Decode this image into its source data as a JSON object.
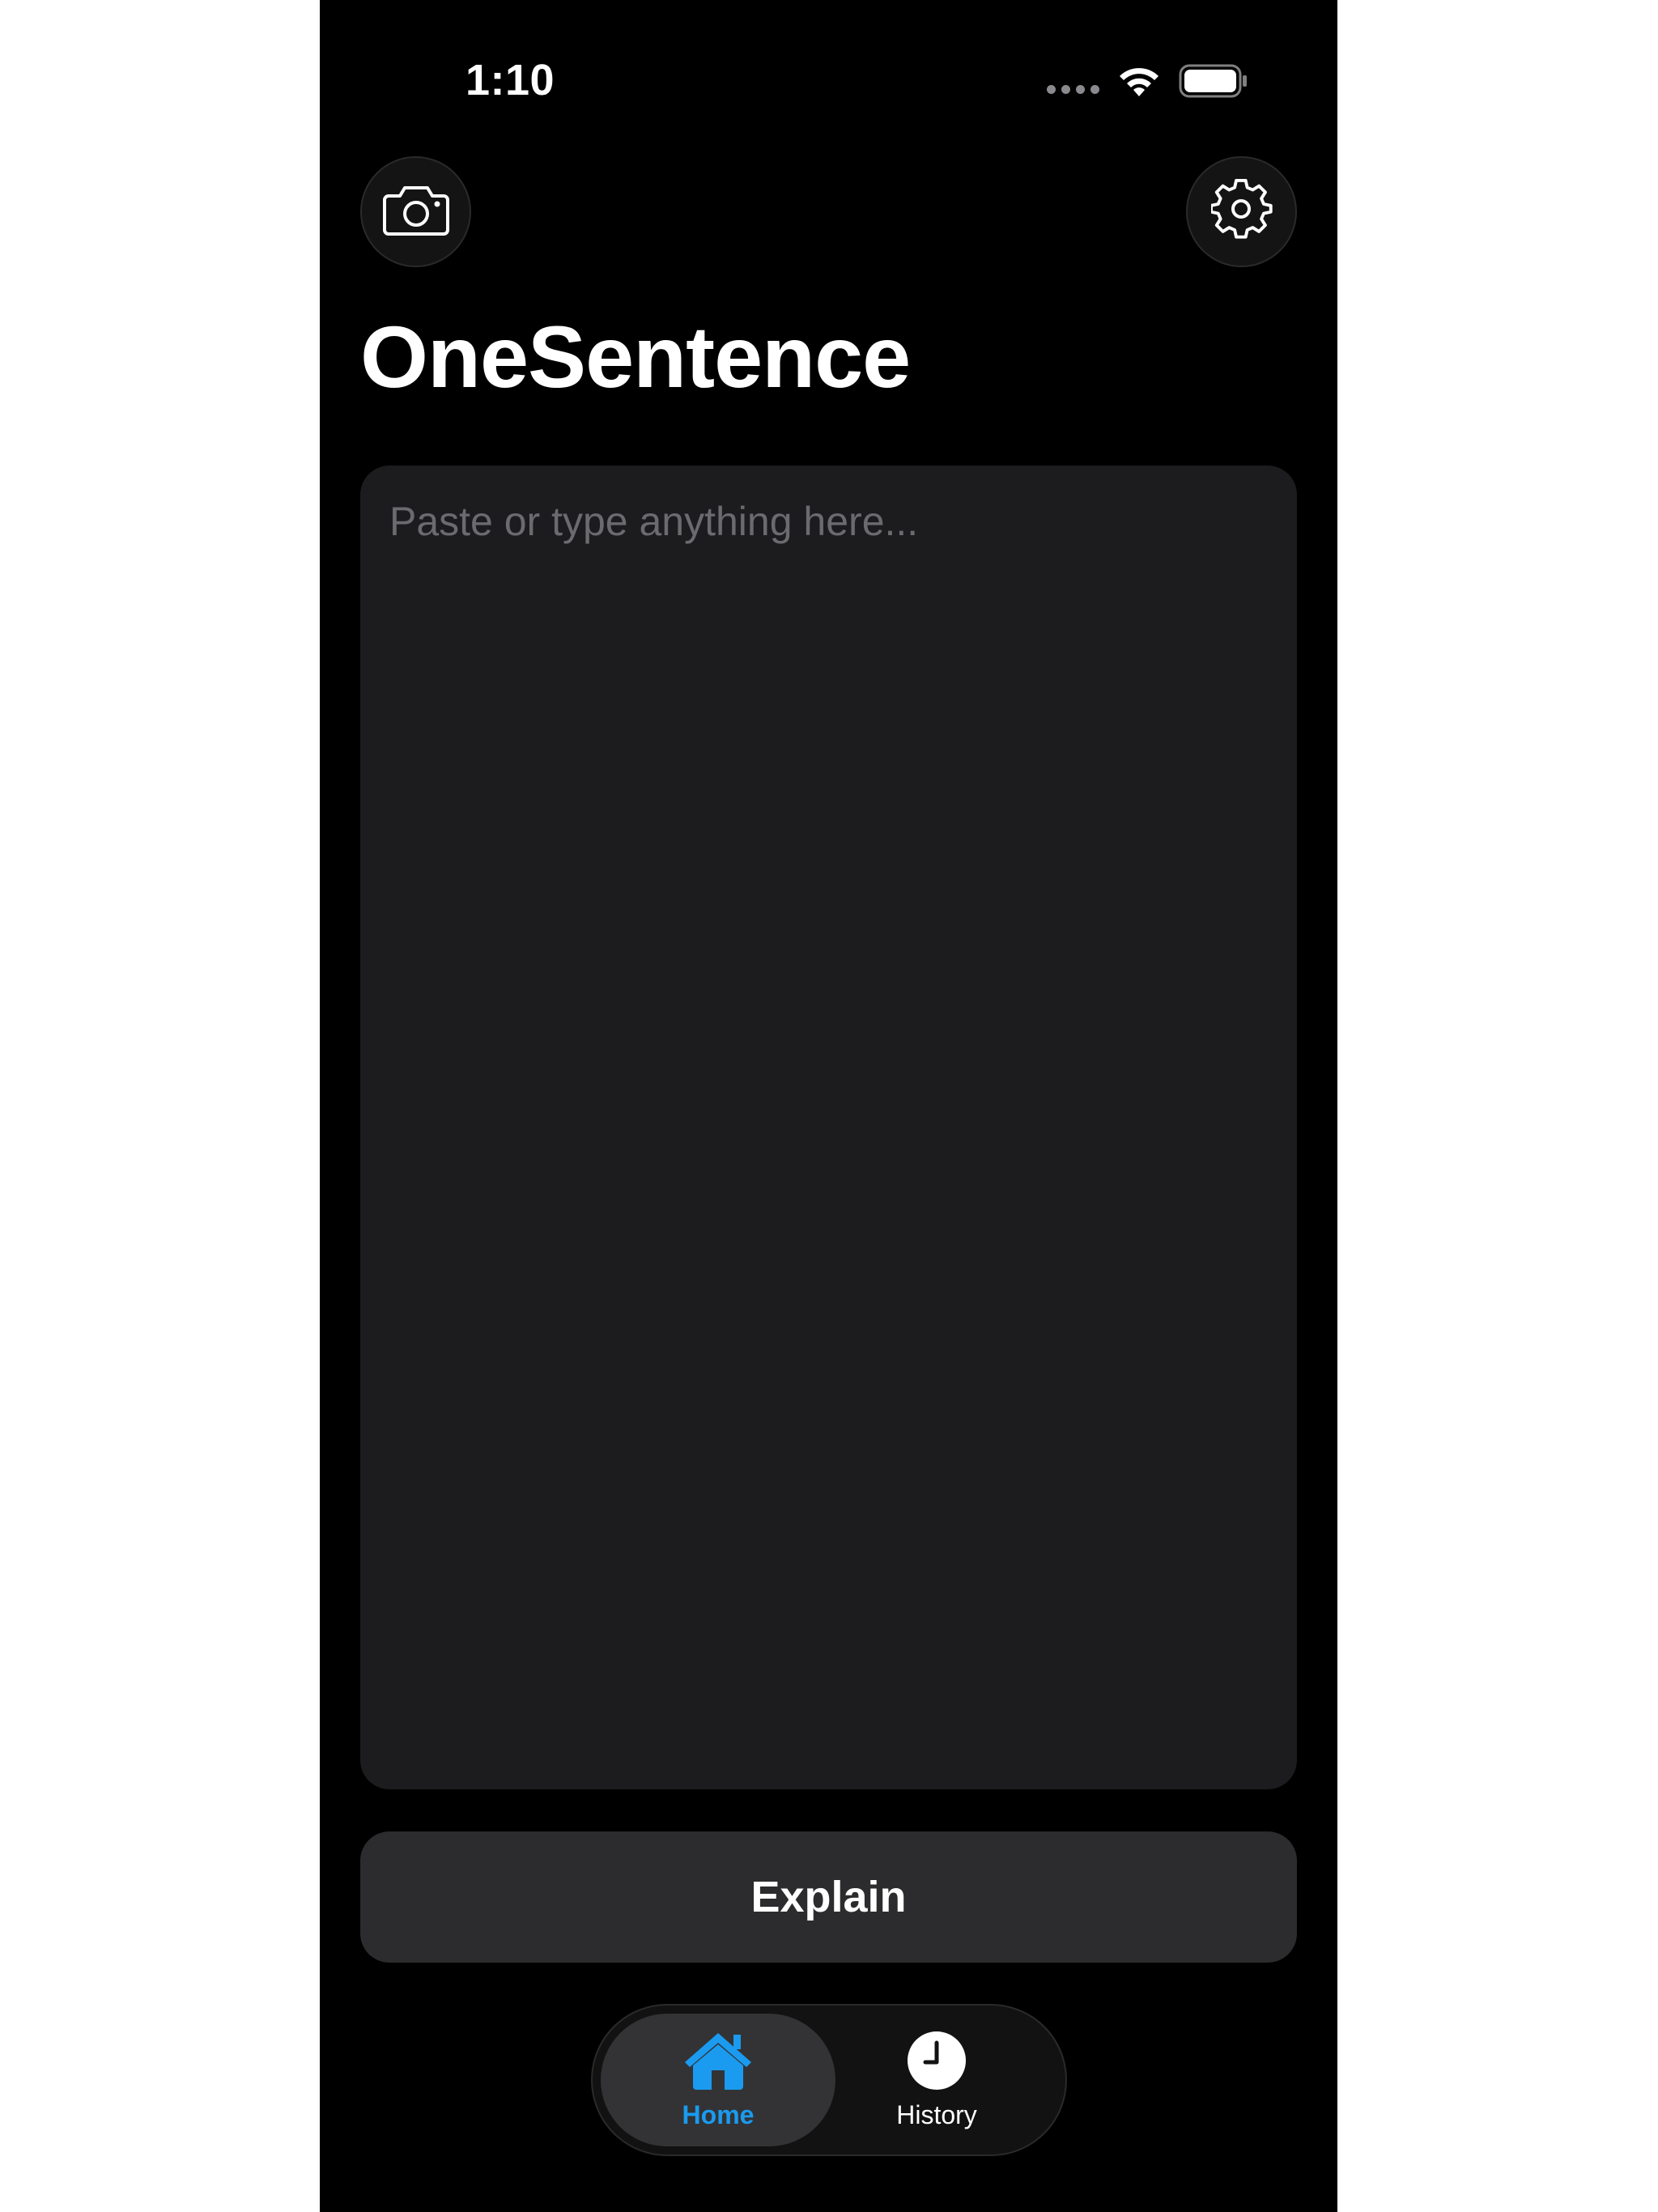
{
  "status_bar": {
    "time": "1:10"
  },
  "header": {
    "camera_icon": "camera-icon",
    "settings_icon": "gear-icon",
    "title": "OneSentence"
  },
  "input": {
    "value": "",
    "placeholder": "Paste or type anything here..."
  },
  "actions": {
    "explain_label": "Explain"
  },
  "tab_bar": {
    "tabs": [
      {
        "label": "Home",
        "icon": "house-icon",
        "selected": true
      },
      {
        "label": "History",
        "icon": "clock-icon",
        "selected": false
      }
    ]
  },
  "colors": {
    "background": "#000000",
    "card": "#1c1c1e",
    "button": "#2c2c2e",
    "accent": "#1a9bf0"
  }
}
